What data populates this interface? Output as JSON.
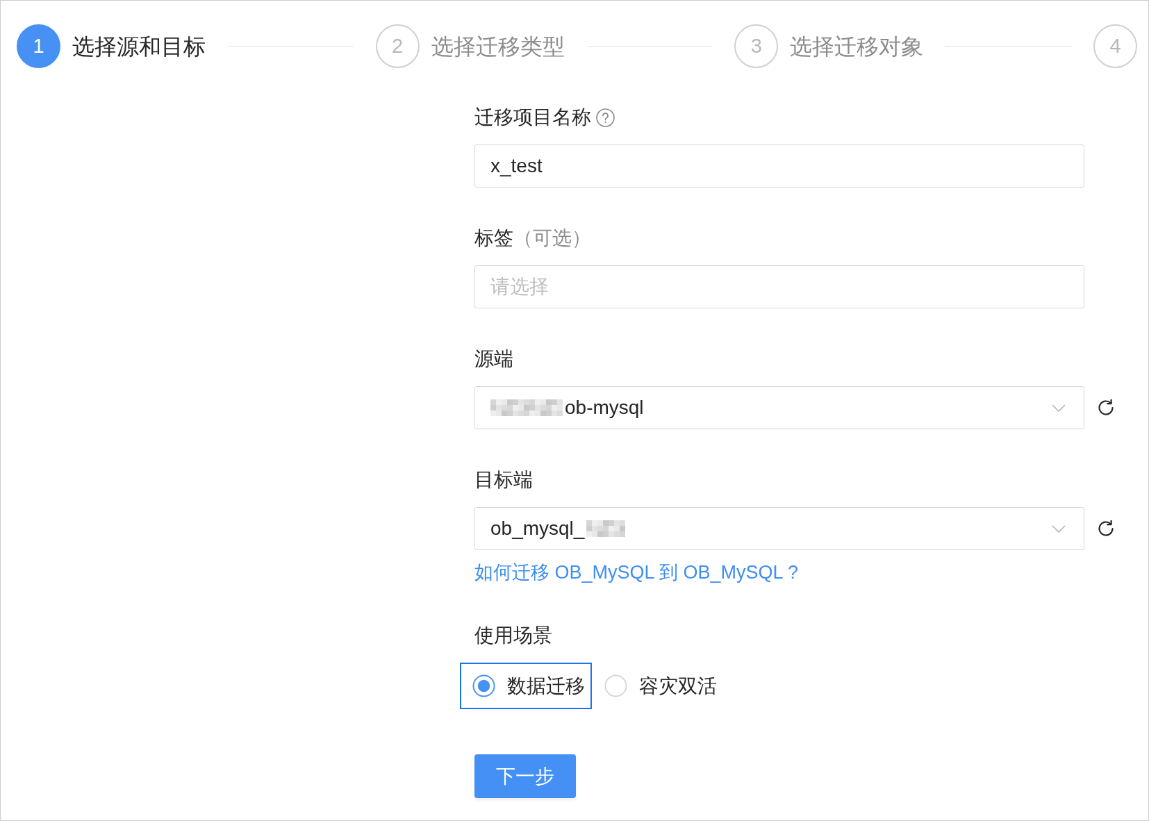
{
  "steps": [
    {
      "number": "1",
      "title": "选择源和目标",
      "active": true
    },
    {
      "number": "2",
      "title": "选择迁移类型",
      "active": false
    },
    {
      "number": "3",
      "title": "选择迁移对象",
      "active": false
    },
    {
      "number": "4",
      "active": false
    }
  ],
  "form": {
    "fields": [
      {
        "kind": "text",
        "label": "迁移项目名称",
        "help": true,
        "value": "x_test"
      },
      {
        "kind": "tags",
        "label": "标签",
        "label_note": "（可选）",
        "placeholder": "请选择"
      },
      {
        "kind": "select",
        "label": "源端",
        "value": "ob-mysql",
        "blurred_prefix": true,
        "refresh": true
      },
      {
        "kind": "select",
        "label": "目标端",
        "value": "ob_mysql_",
        "blurred_suffix": true,
        "refresh": true,
        "link": "如何迁移 OB_MySQL 到 OB_MySQL ?"
      },
      {
        "kind": "radio",
        "label": "使用场景",
        "options": [
          {
            "label": "数据迁移",
            "selected": true,
            "focused": true
          },
          {
            "label": "容灾双活",
            "selected": false,
            "focused": false
          }
        ]
      }
    ],
    "next_button": "下一步"
  }
}
